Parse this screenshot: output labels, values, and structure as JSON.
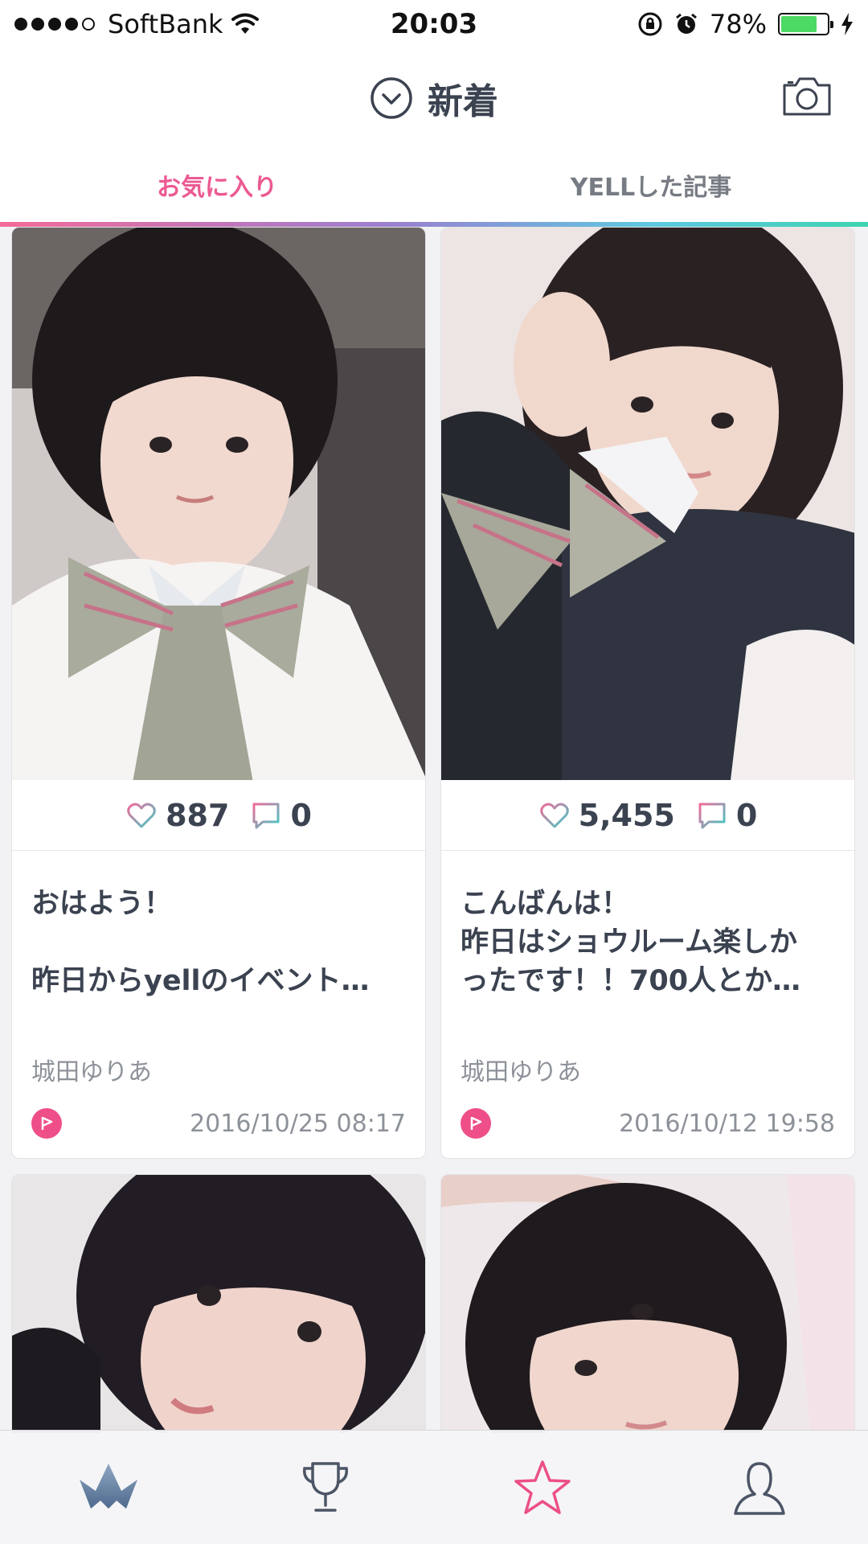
{
  "status_bar": {
    "carrier": "SoftBank",
    "time": "20:03",
    "battery": "78%",
    "battery_level": 0.78,
    "signal_bars": 4
  },
  "header": {
    "title": "新着",
    "dropdown_icon": "chevron-down-circle-icon",
    "camera_icon": "camera-icon"
  },
  "tabs": [
    {
      "label": "お気に入り",
      "active": true
    },
    {
      "label": "YELLした記事",
      "active": false
    }
  ],
  "colors": {
    "accent_pink": "#ec5a92",
    "text_dark": "#3b4250",
    "battery_green": "#4cd964"
  },
  "posts": [
    {
      "likes": "887",
      "comments": "0",
      "text": "おはよう！\n\n昨日からyellのイベント…",
      "author": "城田ゆりあ",
      "date": "2016/10/25 08:17"
    },
    {
      "likes": "5,455",
      "comments": "0",
      "text": "こんばんは！\n昨日はショウルーム楽しか\nったです！！700人とか…",
      "author": "城田ゆりあ",
      "date": "2016/10/12 19:58"
    }
  ],
  "tabbar": [
    {
      "icon": "crown-icon",
      "active": true
    },
    {
      "icon": "trophy-icon",
      "active": false
    },
    {
      "icon": "star-icon",
      "active": false
    },
    {
      "icon": "user-icon",
      "active": false
    }
  ]
}
